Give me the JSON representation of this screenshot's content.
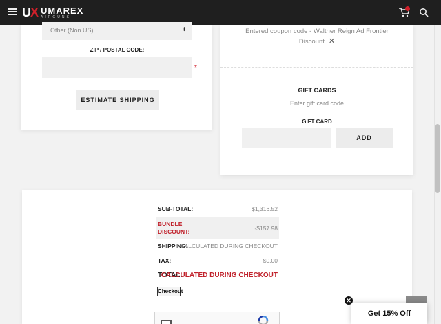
{
  "header": {
    "logo_mark_u": "U",
    "logo_mark_x": "X",
    "logo_word": "UMAREX",
    "logo_sub": "AIRGUNS"
  },
  "shipping": {
    "country_select_value": "Other (Non US)",
    "zip_label": "ZIP / POSTAL CODE:",
    "zip_value": "",
    "required_mark": "*",
    "estimate_button": "ESTIMATE SHIPPING"
  },
  "coupon": {
    "line1": "Entered coupon code - Walther Reign Ad Frontier",
    "line2": "Discount",
    "remove_glyph": "✕"
  },
  "gift_cards": {
    "heading": "GIFT CARDS",
    "hint": "Enter gift card code",
    "field_label": "GIFT CARD",
    "field_value": "",
    "add_button": "ADD"
  },
  "totals": {
    "subtotal_label": "SUB-TOTAL:",
    "subtotal_value": "$1,316.52",
    "bundle_label": "BUNDLE DISCOUNT:",
    "bundle_value": "-$157.98",
    "shipping_label": "SHIPPING:",
    "shipping_value": "CALCULATED DURING CHECKOUT",
    "tax_label": "TAX:",
    "tax_value": "$0.00",
    "total_label": "TOTAL:",
    "total_value": "CALCULATED DURING CHECKOUT",
    "checkout_button": "Checkout"
  },
  "promo": {
    "label": "Get 15% Off",
    "close_glyph": "✕"
  },
  "colors": {
    "brand_red": "#d0202a",
    "header_bg": "#1f1f1f"
  }
}
